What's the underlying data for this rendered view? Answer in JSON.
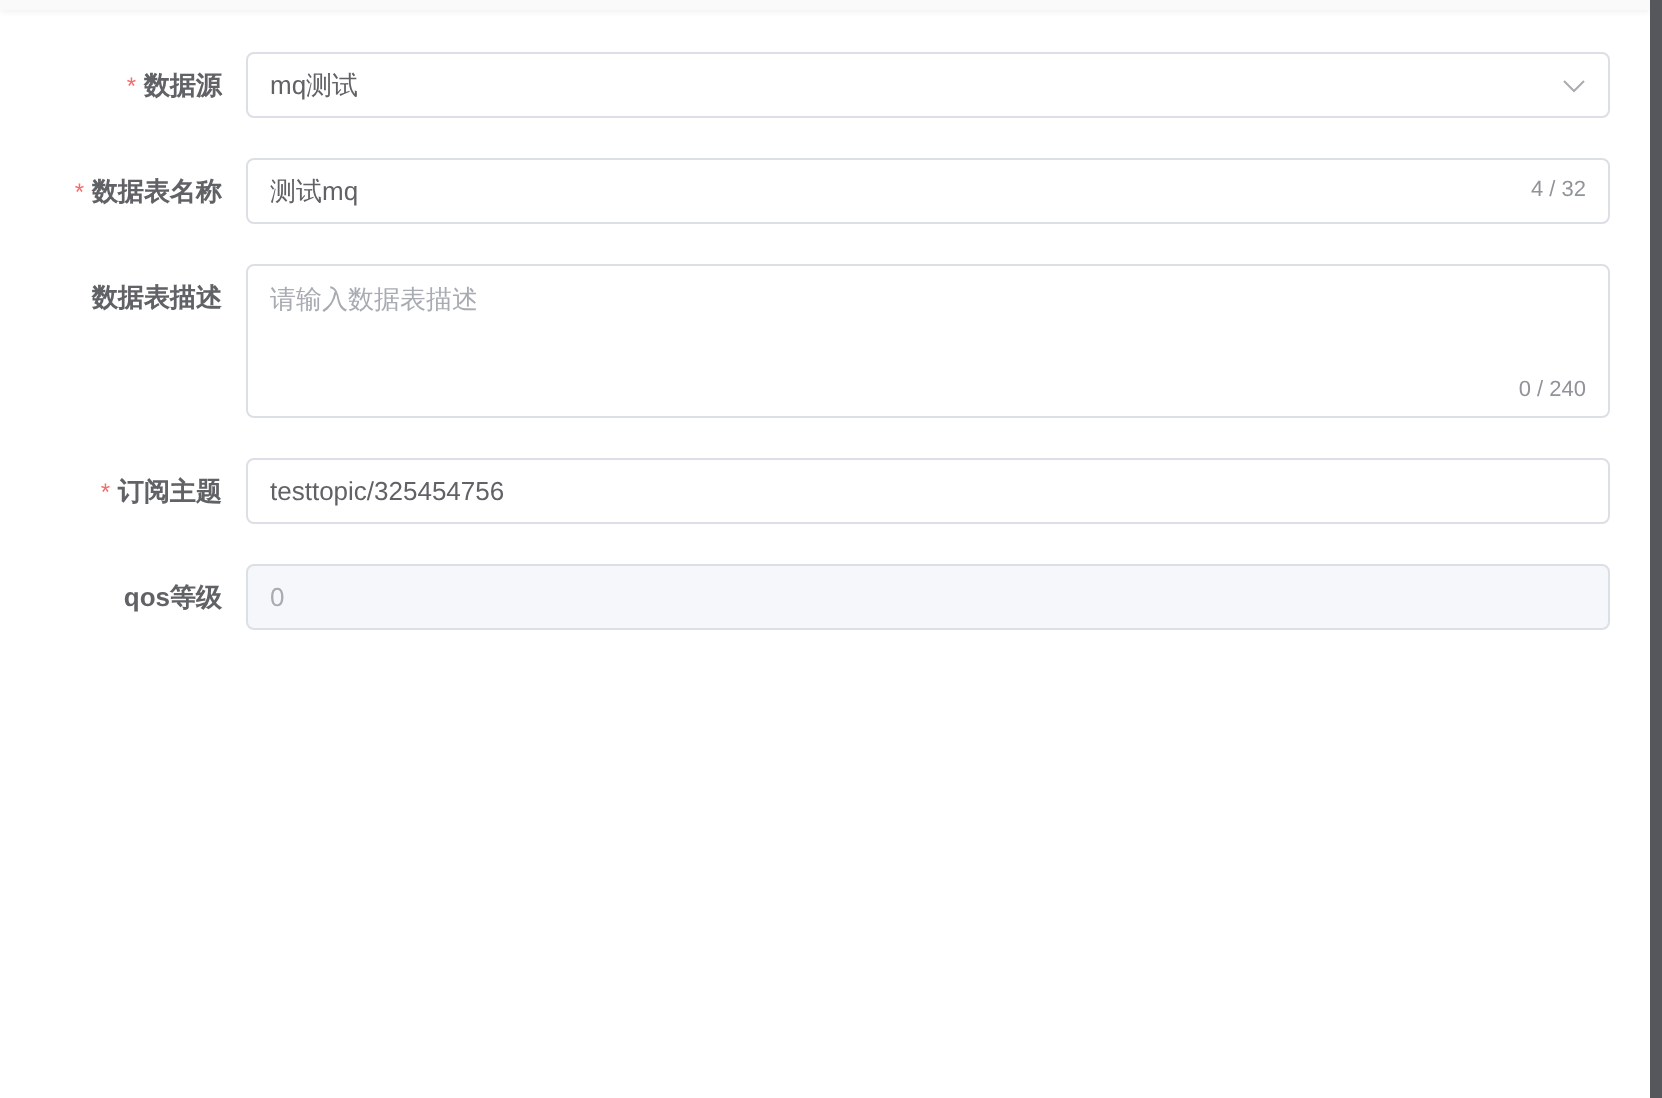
{
  "form": {
    "fields": [
      {
        "kind": "select",
        "label": "数据源",
        "required_mark": "*",
        "value": "mq测试"
      },
      {
        "kind": "input",
        "label": "数据表名称",
        "required_mark": "*",
        "value": "测试mq",
        "counter": "4 / 32"
      },
      {
        "kind": "textarea",
        "label": "数据表描述",
        "placeholder": "请输入数据表描述",
        "counter": "0 / 240"
      },
      {
        "kind": "input",
        "label": "订阅主题",
        "required_mark": "*",
        "value": "testtopic/325454756"
      },
      {
        "kind": "input",
        "label": "qos等级",
        "value": "0",
        "disabled": true
      }
    ]
  }
}
